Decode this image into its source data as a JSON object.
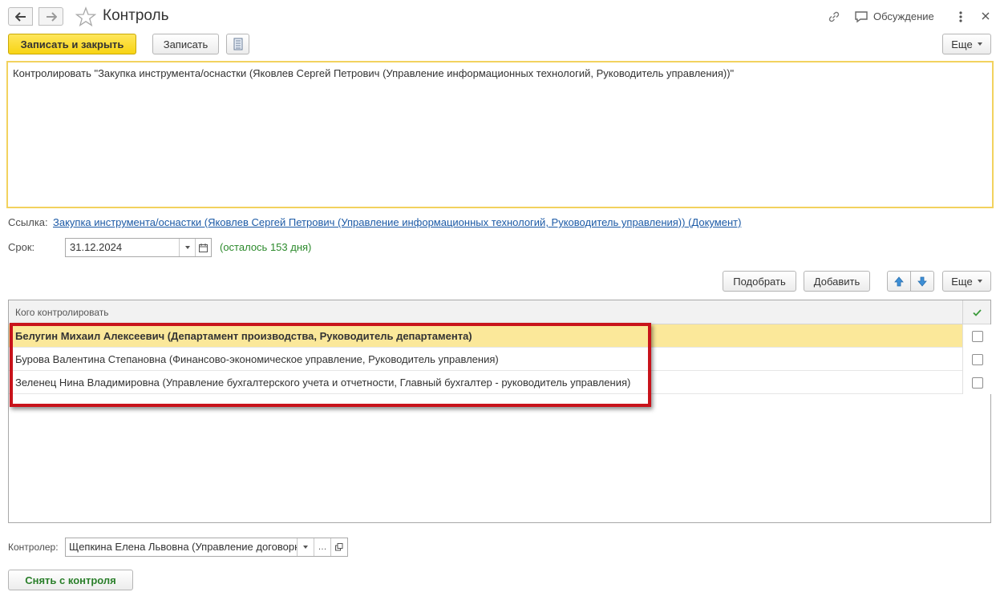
{
  "window": {
    "title": "Контроль",
    "discussion_label": "Обсуждение"
  },
  "toolbar": {
    "save_close_label": "Записать и закрыть",
    "save_label": "Записать",
    "more_label": "Еще"
  },
  "comment": {
    "text": "Контролировать \"Закупка инструмента/оснастки (Яковлев Сергей Петрович (Управление информационных технологий, Руководитель управления))\""
  },
  "reference": {
    "label": "Ссылка:",
    "link_text": "Закупка инструмента/оснастки (Яковлев Сергей Петрович (Управление информационных технологий, Руководитель управления)) (Документ)"
  },
  "deadline": {
    "label": "Срок:",
    "value": "31.12.2024",
    "remaining": "(осталось 153 дня)"
  },
  "list_toolbar": {
    "pick_label": "Подобрать",
    "add_label": "Добавить",
    "more_label": "Еще"
  },
  "table": {
    "column_header": "Кого контролировать",
    "rows": [
      {
        "name": "Белугин Михаил Алексеевич (Департамент производства, Руководитель департамента)",
        "checked": false
      },
      {
        "name": "Бурова Валентина Степановна (Финансово-экономическое управление, Руководитель управления)",
        "checked": false
      },
      {
        "name": "Зеленец Нина Владимировна (Управление бухгалтерского учета и отчетности, Главный бухгалтер - руководитель управления)",
        "checked": false
      }
    ]
  },
  "controller": {
    "label": "Контролер:",
    "value": "Щепкина Елена Львовна (Управление договорн"
  },
  "footer": {
    "remove_label": "Снять с контроля"
  },
  "colors": {
    "primary_button": "#f7d413",
    "selected_row": "#fbe89a",
    "highlight_frame": "#c8131b",
    "link": "#1c5aa6",
    "remaining_text": "#2c8a2c"
  }
}
